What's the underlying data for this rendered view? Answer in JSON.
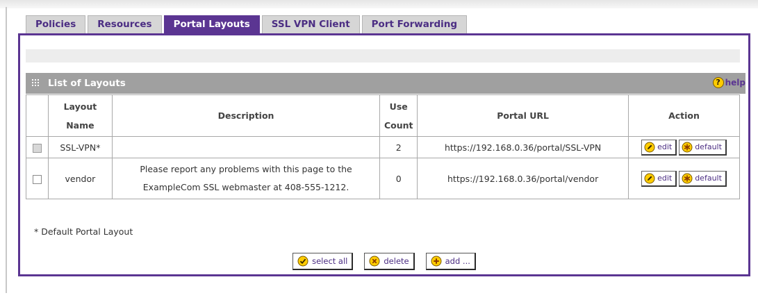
{
  "tabs": [
    {
      "label": "Policies",
      "active": false
    },
    {
      "label": "Resources",
      "active": false
    },
    {
      "label": "Portal Layouts",
      "active": true
    },
    {
      "label": "SSL VPN Client",
      "active": false
    },
    {
      "label": "Port Forwarding",
      "active": false
    }
  ],
  "section": {
    "title": "List of Layouts",
    "help_label": "help"
  },
  "table": {
    "headers": {
      "layout_name_1": "Layout",
      "layout_name_2": "Name",
      "description": "Description",
      "use_count_1": "Use",
      "use_count_2": "Count",
      "portal_url": "Portal URL",
      "action": "Action"
    },
    "rows": [
      {
        "checkbox_disabled": true,
        "name": "SSL-VPN*",
        "description_1": "",
        "description_2": "",
        "use_count": "2",
        "portal_url": "https://192.168.0.36/portal/SSL-VPN",
        "edit_label": "edit",
        "default_label": "default"
      },
      {
        "checkbox_disabled": false,
        "name": "vendor",
        "description_1": "Please report any problems with this page to the",
        "description_2": "ExampleCom SSL webmaster at 408-555-1212.",
        "use_count": "0",
        "portal_url": "https://192.168.0.36/portal/vendor",
        "edit_label": "edit",
        "default_label": "default"
      }
    ]
  },
  "footnote": "* Default Portal Layout",
  "buttons": {
    "select_all": "select all",
    "delete": "delete",
    "add": "add ..."
  },
  "colors": {
    "accent": "#5b3592",
    "tab_inactive": "#d6d6d6",
    "titlebar": "#a0a0a0",
    "icon_yellow": "#ffcc00"
  },
  "icons": {
    "section": "grid-icon",
    "help": "help-icon",
    "edit": "pencil-icon",
    "default": "asterisk-icon",
    "select_all": "check-icon",
    "delete": "x-icon",
    "add": "plus-icon"
  }
}
